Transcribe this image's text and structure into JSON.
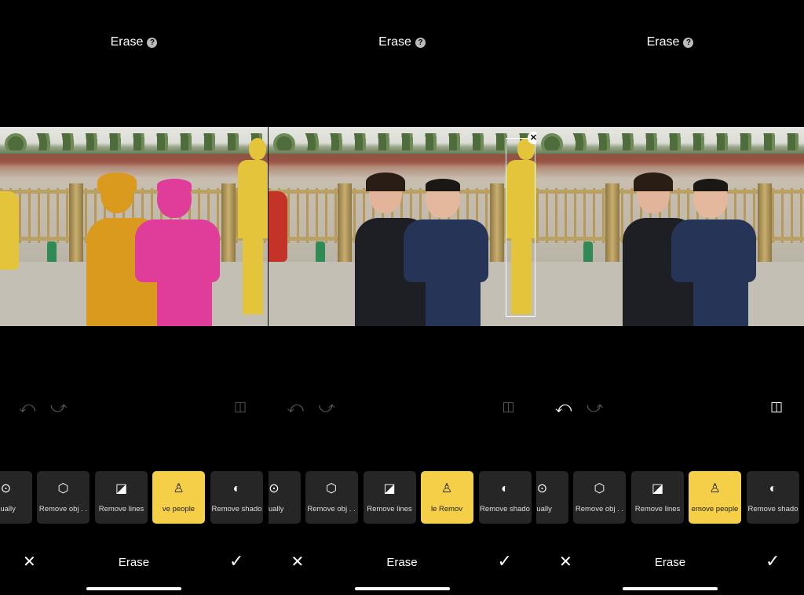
{
  "colors": {
    "accent": "#f5cf47",
    "chip_bg": "#262626",
    "mask_woman": "#d99a1e",
    "mask_child": "#e03c9a",
    "mask_bystander": "#e4c43a"
  },
  "panels": [
    {
      "title": "Erase",
      "help_icon": "question-circle-icon",
      "undo_enabled": false,
      "redo_enabled": false,
      "compare_enabled": false,
      "state": "people-highlighted",
      "tools": [
        {
          "label": "Manually",
          "visible": "nually",
          "icon": "target-icon"
        },
        {
          "label": "Remove obj..",
          "visible": "Remove obj . .",
          "icon": "cube-icon"
        },
        {
          "label": "Remove lines",
          "visible": "Remove lines",
          "icon": "slash-square-icon"
        },
        {
          "label": "Remove people",
          "visible": "ve people",
          "icon": "person-icon",
          "active": true
        },
        {
          "label": "Remove shadows",
          "visible": "Remove shado",
          "icon": "shadow-icon"
        }
      ],
      "cancel": "✕",
      "bottom_title": "Erase",
      "confirm": "✓"
    },
    {
      "title": "Erase",
      "help_icon": "question-circle-icon",
      "undo_enabled": false,
      "redo_enabled": false,
      "compare_enabled": false,
      "state": "bystander-selected",
      "tools": [
        {
          "label": "Manually",
          "visible": "nually",
          "icon": "target-icon"
        },
        {
          "label": "Remove obj..",
          "visible": "Remove obj . .",
          "icon": "cube-icon"
        },
        {
          "label": "Remove lines",
          "visible": "Remove lines",
          "icon": "slash-square-icon"
        },
        {
          "label": "Remove people",
          "visible": "le        Remov",
          "icon": "person-icon",
          "active": true
        },
        {
          "label": "Remove shadows",
          "visible": "Remove shado",
          "icon": "shadow-icon"
        }
      ],
      "cancel": "✕",
      "bottom_title": "Erase",
      "confirm": "✓"
    },
    {
      "title": "Erase",
      "help_icon": "question-circle-icon",
      "undo_enabled": true,
      "redo_enabled": false,
      "compare_enabled": true,
      "state": "bystander-removed",
      "tools": [
        {
          "label": "Manually",
          "visible": "nually",
          "icon": "target-icon"
        },
        {
          "label": "Remove obj..",
          "visible": "Remove obj . .",
          "icon": "cube-icon"
        },
        {
          "label": "Remove lines",
          "visible": "Remove lines",
          "icon": "slash-square-icon"
        },
        {
          "label": "Remove people",
          "visible": "emove people",
          "icon": "person-icon",
          "active": true
        },
        {
          "label": "Remove shadows",
          "visible": "Remove shado",
          "icon": "shadow-icon"
        }
      ],
      "cancel": "✕",
      "bottom_title": "Erase",
      "confirm": "✓"
    }
  ]
}
